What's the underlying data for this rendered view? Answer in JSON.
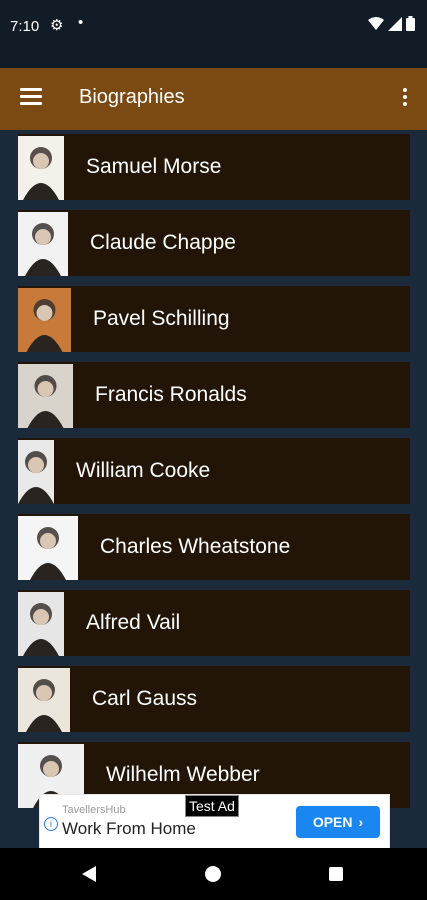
{
  "status_bar": {
    "time": "7:10"
  },
  "app_bar": {
    "title": "Biographies"
  },
  "people": [
    {
      "name": "Samuel Morse",
      "thumb_width": 46
    },
    {
      "name": "Claude Chappe",
      "thumb_width": 50
    },
    {
      "name": "Pavel Schilling",
      "thumb_width": 53
    },
    {
      "name": "Francis Ronalds",
      "thumb_width": 55
    },
    {
      "name": "William Cooke",
      "thumb_width": 36
    },
    {
      "name": "Charles Wheatstone",
      "thumb_width": 60
    },
    {
      "name": "Alfred Vail",
      "thumb_width": 46
    },
    {
      "name": "Carl Gauss",
      "thumb_width": 52
    },
    {
      "name": "Wilhelm Webber",
      "thumb_width": 66
    }
  ],
  "ad": {
    "label": "Test Ad",
    "source": "TavellersHub",
    "headline": "Work From Home",
    "cta": "OPEN"
  },
  "colors": {
    "app_bar": "#7b4a12",
    "background": "#1b2a3a",
    "item": "#221508",
    "cta": "#1a86f0"
  }
}
